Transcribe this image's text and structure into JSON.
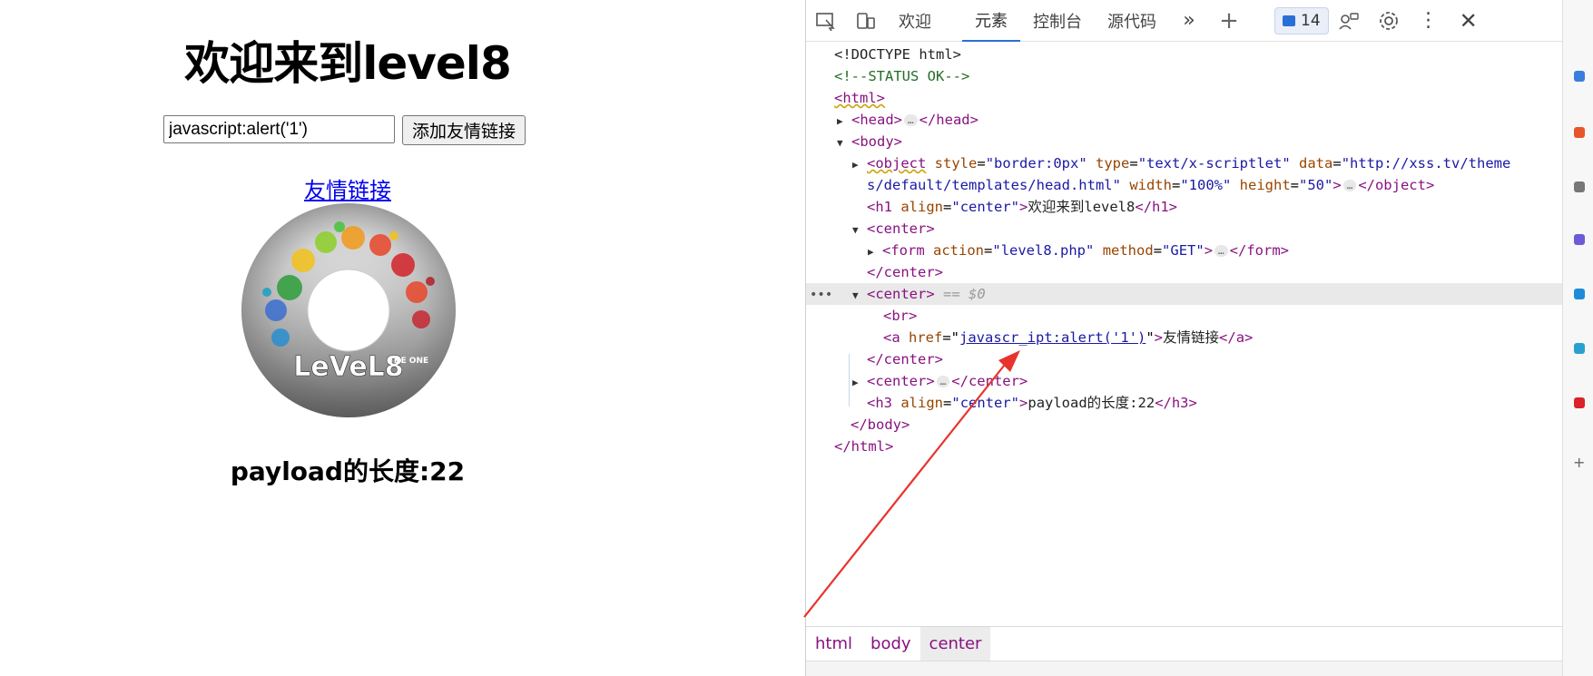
{
  "page": {
    "title": "欢迎来到level8",
    "input_value": "javascript:alert('1')",
    "submit_label": "添加友情链接",
    "friend_link": "友情链接",
    "payload_length": "payload的长度:22",
    "disc_label": "LeVeL8",
    "disc_sub": "THE ONE"
  },
  "devtools": {
    "tabs": [
      {
        "label": "欢迎"
      },
      {
        "label": "元素"
      },
      {
        "label": "控制台"
      },
      {
        "label": "源代码"
      }
    ],
    "issues_count": "14",
    "breadcrumbs": [
      "html",
      "body",
      "center"
    ],
    "dom": {
      "doctype": "<!DOCTYPE html>",
      "comment": "<!--STATUS OK-->",
      "html_open": "<html>",
      "head_open": "<head>",
      "head_close": "</head>",
      "body_open": "<body>",
      "object_tag_open": "<object",
      "object_attr_style": "style",
      "object_val_style": "\"border:0px\"",
      "object_attr_type": "type",
      "object_val_type": "\"text/x-scriptlet\"",
      "object_attr_data": "data",
      "object_val_data_1": "\"http://xss.tv/theme",
      "object_val_data_2": "s/default/templates/head.html\"",
      "object_attr_width": "width",
      "object_val_width": "\"100%\"",
      "object_attr_height": "height",
      "object_val_height": "\"50\"",
      "object_close": "</object>",
      "h1_open": "<h1",
      "h1_attr": "align",
      "h1_val": "\"center\"",
      "h1_text": "欢迎来到level8",
      "h1_close": "</h1>",
      "center_open": "<center>",
      "form_open": "<form",
      "form_attr_action": "action",
      "form_val_action": "\"level8.php\"",
      "form_attr_method": "method",
      "form_val_method": "\"GET\"",
      "form_close": "</form>",
      "center_close": "</center>",
      "selected_marker": "== $0",
      "br": "<br>",
      "a_open": "<a",
      "a_attr": "href",
      "a_href": "javascr_ipt:alert('1')",
      "a_text": "友情链接",
      "a_close": "</a>",
      "h3_open": "<h3",
      "h3_attr": "align",
      "h3_val": "\"center\"",
      "h3_text": "payload的长度:22",
      "h3_close": "</h3>",
      "body_close": "</body>",
      "html_close": "</html>"
    }
  },
  "colors": {
    "annotation_arrow": "#e8332d",
    "selected_tab_underline": "#2a6fd6"
  }
}
